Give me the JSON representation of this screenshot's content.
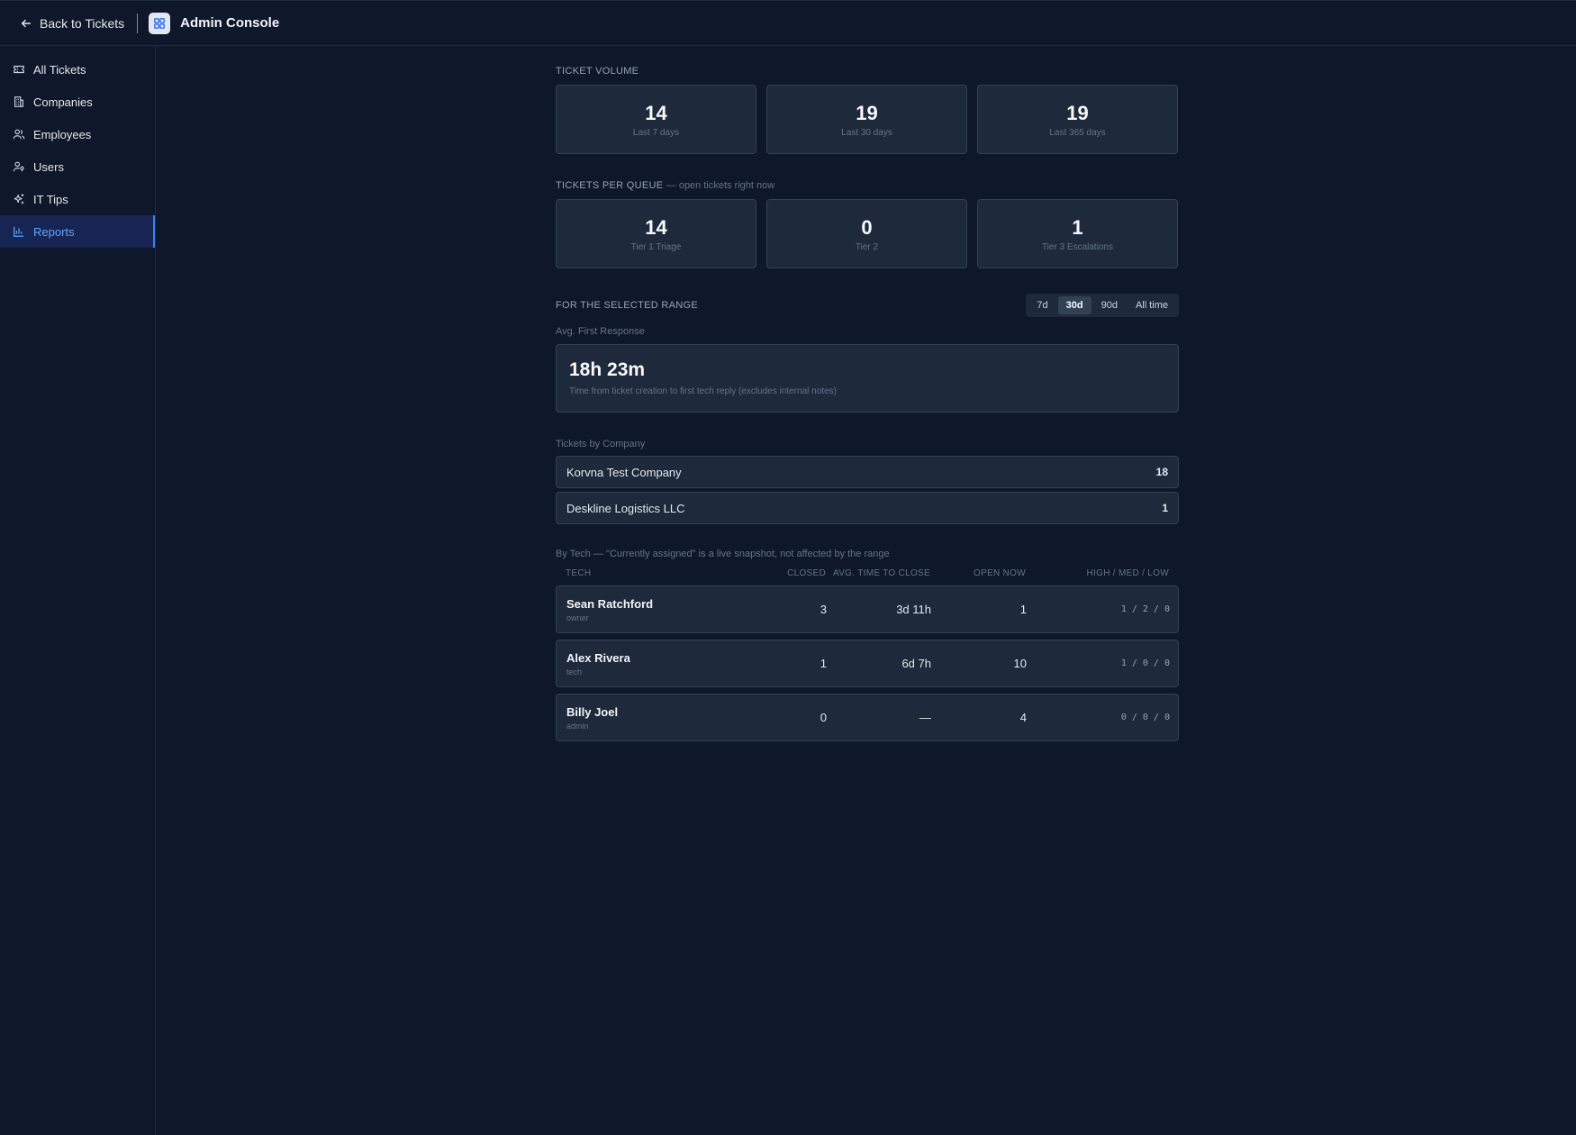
{
  "header": {
    "back_label": "Back to Tickets",
    "title": "Admin Console"
  },
  "sidebar": {
    "items": [
      {
        "label": "All Tickets",
        "icon": "ticket-icon"
      },
      {
        "label": "Companies",
        "icon": "building-icon"
      },
      {
        "label": "Employees",
        "icon": "users-icon"
      },
      {
        "label": "Users",
        "icon": "user-key-icon"
      },
      {
        "label": "IT Tips",
        "icon": "sparkle-icon"
      },
      {
        "label": "Reports",
        "icon": "chart-icon",
        "active": true
      }
    ]
  },
  "ticket_volume": {
    "label": "TICKET VOLUME",
    "cards": [
      {
        "value": "14",
        "label": "Last 7 days"
      },
      {
        "value": "19",
        "label": "Last 30 days"
      },
      {
        "value": "19",
        "label": "Last 365 days"
      }
    ]
  },
  "queues": {
    "label": "TICKETS PER QUEUE",
    "sublabel": "— open tickets right now",
    "cards": [
      {
        "value": "14",
        "label": "Tier 1 Triage"
      },
      {
        "value": "0",
        "label": "Tier 2"
      },
      {
        "value": "1",
        "label": "Tier 3 Escalations"
      }
    ]
  },
  "range": {
    "label": "FOR THE SELECTED RANGE",
    "tabs": [
      "7d",
      "30d",
      "90d",
      "All time"
    ],
    "active_tab": "30d"
  },
  "first_response": {
    "label": "Avg. First Response",
    "value": "18h 23m",
    "description": "Time from ticket creation to first tech reply (excludes internal notes)"
  },
  "companies": {
    "label": "Tickets by Company",
    "rows": [
      {
        "name": "Korvna Test Company",
        "count": "18"
      },
      {
        "name": "Deskline Logistics LLC",
        "count": "1"
      }
    ]
  },
  "by_tech": {
    "label": "By Tech — \"Currently assigned\" is a live snapshot, not affected by the range",
    "columns": [
      "TECH",
      "CLOSED",
      "AVG. TIME TO CLOSE",
      "OPEN NOW",
      "HIGH / MED / LOW"
    ],
    "rows": [
      {
        "name": "Sean Ratchford",
        "role": "owner",
        "closed": "3",
        "avg": "3d 11h",
        "open": "1",
        "hml": "1 / 2 / 0"
      },
      {
        "name": "Alex Rivera",
        "role": "tech",
        "closed": "1",
        "avg": "6d 7h",
        "open": "10",
        "hml": "1 / 0 / 0"
      },
      {
        "name": "Billy Joel",
        "role": "admin",
        "closed": "0",
        "avg": "—",
        "open": "4",
        "hml": "0 / 0 / 0"
      }
    ]
  },
  "colors": {
    "background": "#0f172a",
    "card": "#1e293b",
    "border": "#334155",
    "accent": "#60a5fa"
  }
}
